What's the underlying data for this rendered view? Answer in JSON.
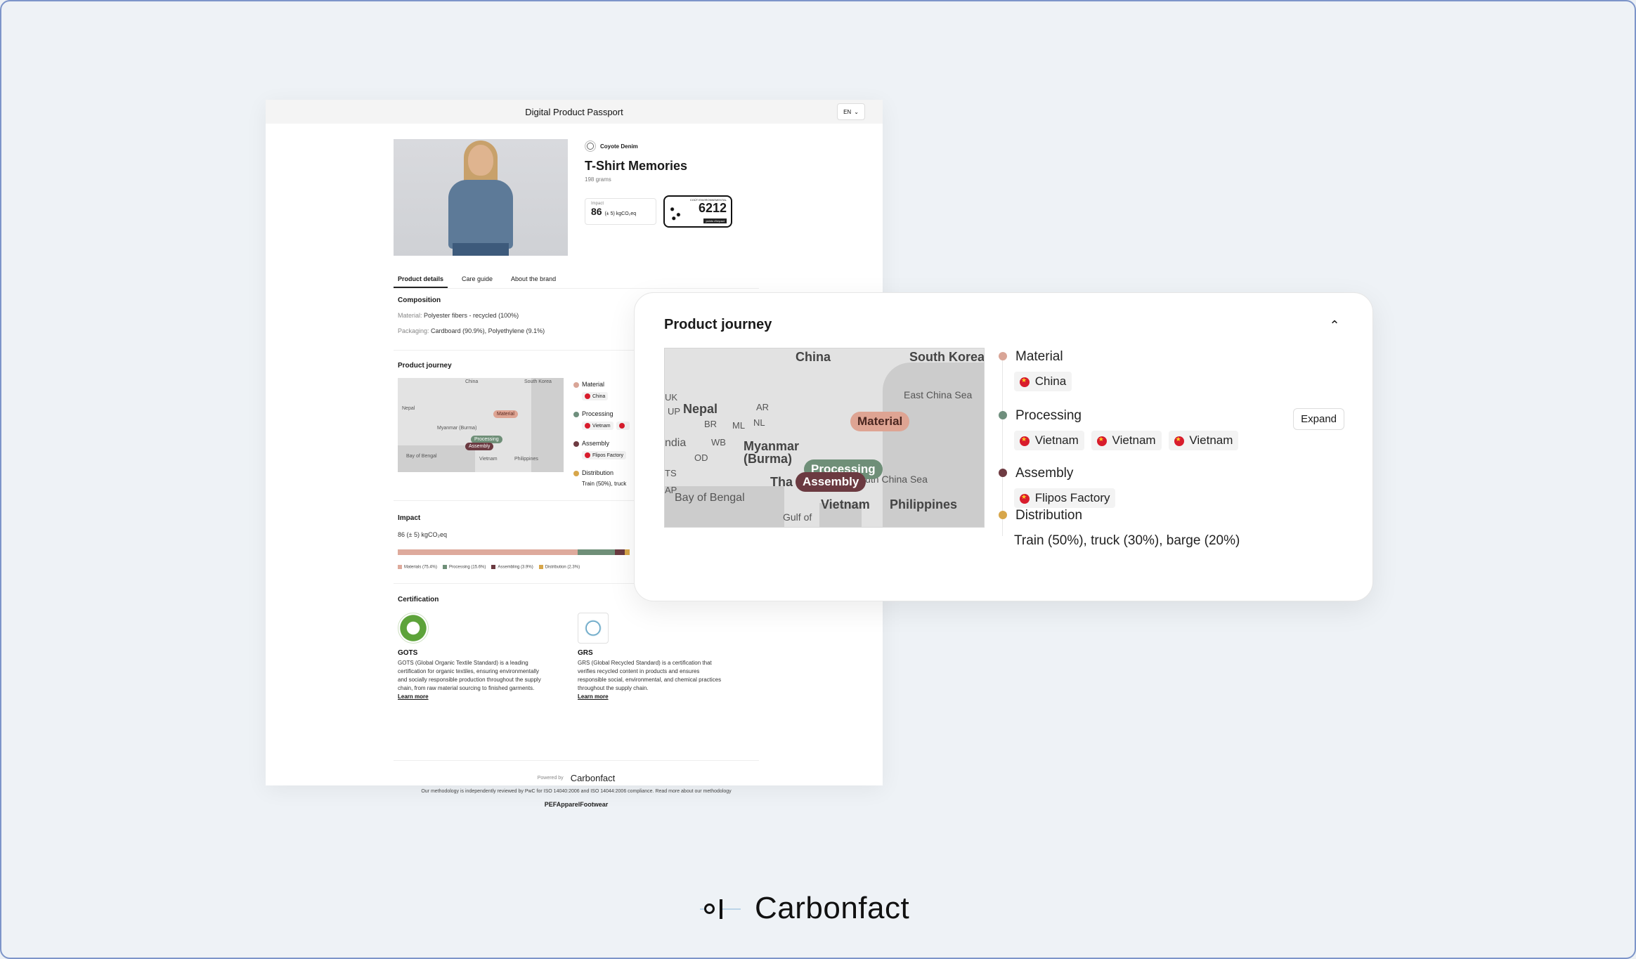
{
  "dpp": {
    "header_title": "Digital Product Passport",
    "lang": "EN",
    "brand": "Coyote Denim",
    "product_title": "T-Shirt Memories",
    "weight": "198 grams",
    "impact_label": "Impact",
    "impact_value": "86",
    "impact_unit": "(± 5) kgCO₂eq",
    "score_value": "6212",
    "score_small": "COÛT ENVIRONNEMENTAL",
    "score_tag": "points d'impact",
    "tabs": [
      "Product details",
      "Care guide",
      "About the brand"
    ],
    "composition_title": "Composition",
    "material_key": "Material:",
    "material_val": "Polyester fibers - recycled (100%)",
    "packaging_key": "Packaging:",
    "packaging_val": "Cardboard (90.9%), Polyethylene (9.1%)",
    "journey_title": "Product journey",
    "impact_title": "Impact",
    "impact_line": "86 (± 5) kgCO₂eq",
    "legend": [
      "Materials (75.4%)",
      "Processing (15.6%)",
      "Assembling (3.9%)",
      "Distribution (2.3%)"
    ],
    "legend_share": [
      75.4,
      15.6,
      3.9,
      2.3
    ],
    "cert_title": "Certification",
    "certs": [
      {
        "name": "GOTS",
        "desc": "GOTS (Global Organic Textile Standard) is a leading certification for organic textiles, ensuring environmentally and socially responsible production throughout the supply chain, from raw material sourcing to finished garments.",
        "more": "Learn more"
      },
      {
        "name": "GRS",
        "desc": "GRS (Global Recycled Standard) is a certification that verifies recycled content in products and ensures responsible social, environmental, and chemical practices throughout the supply chain.",
        "more": "Learn more"
      }
    ],
    "powered_by": "Powered by",
    "carbonfact": "Carbonfact",
    "methodology": "Our methodology is independently reviewed by PwC for ISO 14040:2006 and ISO 14044:2006 compliance. Read more about our methodology",
    "pef": "PEFApparelFootwear"
  },
  "journey": {
    "title": "Product journey",
    "expand": "Expand",
    "stages": [
      {
        "name": "Material",
        "color": "#d9a597",
        "chips": [
          "China"
        ]
      },
      {
        "name": "Processing",
        "color": "#6f8f7d",
        "chips": [
          "Vietnam",
          "Vietnam",
          "Vietnam"
        ]
      },
      {
        "name": "Assembly",
        "color": "#6e3b42",
        "chips": [
          "Flipos Factory"
        ]
      },
      {
        "name": "Distribution",
        "color": "#d7a64a",
        "text": "Train (50%), truck (30%), barge (20%)"
      }
    ],
    "map_labels": {
      "china": "China",
      "south_korea": "South Korea",
      "east_china_sea": "East China Sea",
      "nepal": "Nepal",
      "india": "ndia",
      "uk": "UK",
      "up": "UP",
      "ar": "AR",
      "br": "BR",
      "ml": "ML",
      "nl": "NL",
      "wb": "WB",
      "od": "OD",
      "ts": "TS",
      "ap": "AP",
      "myanmar": "Myanmar (Burma)",
      "tha": "Tha",
      "bay": "Bay of Bengal",
      "gulf": "Gulf of",
      "vietnam": "Vietnam",
      "philippines": "Philippines",
      "south_china": "South China Sea"
    },
    "pills": {
      "material": "Material",
      "processing": "Processing",
      "assembly": "Assembly"
    },
    "colors": {
      "material": "#dea493",
      "processing": "#6f8f78",
      "assembly": "#6b3a41",
      "distribution": "#d7a64a"
    }
  },
  "bottom_brand": "Carbonfact"
}
